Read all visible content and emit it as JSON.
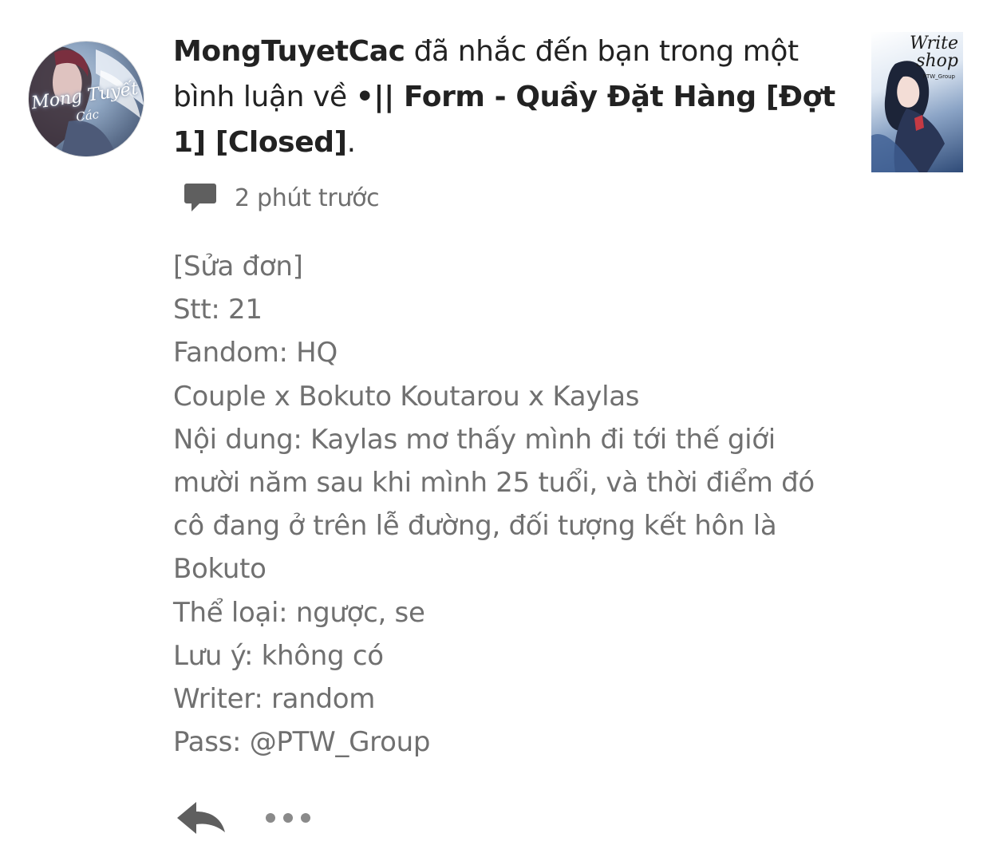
{
  "notification": {
    "username": "MongTuyetCac",
    "action_text": " đã nhắc đến bạn trong một bình luận về ",
    "story_title": "•|| Form - Quầy Đặt Hàng [Đợt 1] [Closed]",
    "trailing_punct": ".",
    "time": "2 phút trước",
    "avatar_caption": "Mong Tuyết",
    "avatar_caption_sub": "Các",
    "thumbnail_title": "Write shop",
    "thumbnail_subtitle": "PTW_Group"
  },
  "comment": {
    "lines": [
      "[Sửa đơn]",
      "Stt: 21",
      "Fandom: HQ",
      "Couple x Bokuto Koutarou x Kaylas",
      "Nội dung: Kaylas mơ thấy mình đi tới thế giới",
      "mười năm sau khi mình 25 tuổi, và thời điểm đó",
      "cô đang ở trên lễ đường, đối tượng kết hôn là",
      "Bokuto",
      "Thể loại: ngược, se",
      "Lưu ý: không có",
      "Writer: random",
      "Pass: @PTW_Group"
    ]
  },
  "icons": {
    "comment": "comment-icon",
    "reply": "reply-icon",
    "more": "more-icon"
  },
  "colors": {
    "text_primary": "#222222",
    "text_secondary": "#707070",
    "icon_gray": "#5f5f5f"
  }
}
